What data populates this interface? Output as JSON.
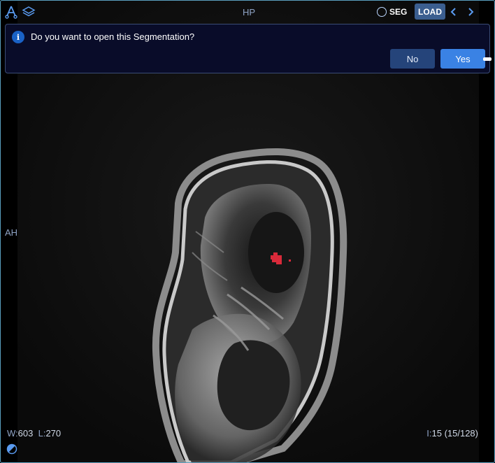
{
  "viewport": {
    "orientation_top": "HP",
    "orientation_left": "AH",
    "window_label": "W:",
    "window_value": "603",
    "level_label": "L:",
    "level_value": "270",
    "slice_label": "I:",
    "slice_value": "15 (15/128)"
  },
  "toolbar": {
    "seg_label": "SEG",
    "load_label": "LOAD",
    "icons": [
      "annotation-tool-icon",
      "layers-icon",
      "circle-icon",
      "chevron-left-icon",
      "chevron-right-icon",
      "contrast-icon"
    ]
  },
  "dialog": {
    "info_glyph": "i",
    "message": "Do you want to open this Segmentation?",
    "no_label": "No",
    "yes_label": "Yes"
  },
  "colors": {
    "accent": "#3a82e4",
    "dialog_bg": "#090c29",
    "load_bg": "#3b5e8f",
    "segmentation": "#d92a3a"
  }
}
